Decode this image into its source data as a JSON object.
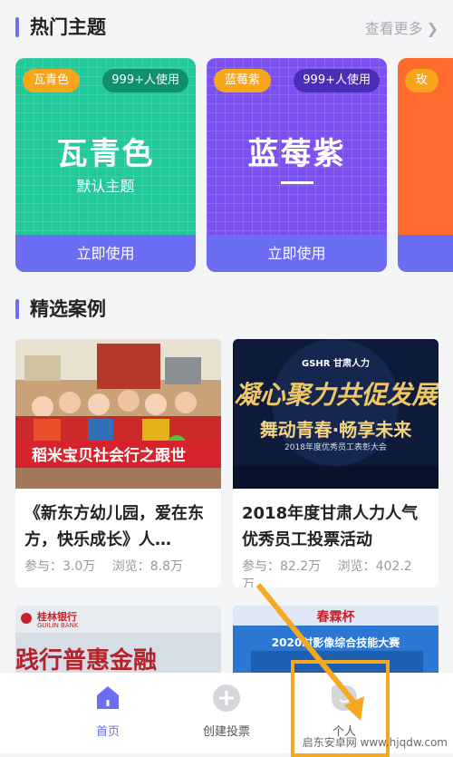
{
  "hot": {
    "title": "热门主题",
    "more": "查看更多",
    "more_icon": "chevron-right-icon",
    "themes": [
      {
        "tag": "瓦青色",
        "users": "999+人使用",
        "name": "瓦青色",
        "sub": "默认主题",
        "button": "立即使用",
        "color": "#20c89a",
        "btn_color": "#6b6df2"
      },
      {
        "tag": "蓝莓紫",
        "users": "999+人使用",
        "name": "蓝莓紫",
        "button": "立即使用",
        "color": "#7b4ff2",
        "btn_color": "#6b6df2"
      },
      {
        "tag": "玫",
        "color": "#ff6b2d"
      }
    ]
  },
  "featured": {
    "title": "精选案例",
    "cases": [
      {
        "title": "《新东方幼儿园，爱在东方，快乐成长》人…",
        "join": "参与：3.0万",
        "view": "浏览：8.8万",
        "banner": "稻米宝贝社会行之跟世"
      },
      {
        "title": "2018年度甘肃人力人气优秀员工投票活动",
        "join": "参与：82.2万",
        "view": "浏览：402.2万",
        "logo": "GSHR 甘肃人力",
        "headline": "凝心聚力共促发展",
        "slogan": "舞动青春·畅享未来",
        "subline": "2018年度优秀员工表彰大会"
      }
    ],
    "previews": [
      {
        "bank_cn": "桂林银行",
        "bank_en": "GUILIN BANK",
        "headline": "践行普惠金融"
      },
      {
        "headline": "春霖杯",
        "sub": "2020时影像综合技能大赛"
      }
    ]
  },
  "tabbar": {
    "items": [
      {
        "label": "首页",
        "icon": "home-icon"
      },
      {
        "label": "创建投票",
        "icon": "plus-circle-icon"
      },
      {
        "label": "个人",
        "icon": "profile-icon"
      }
    ]
  },
  "accent": "#6b6df2",
  "watermark": "启东安卓网 www.hjqdw.com"
}
